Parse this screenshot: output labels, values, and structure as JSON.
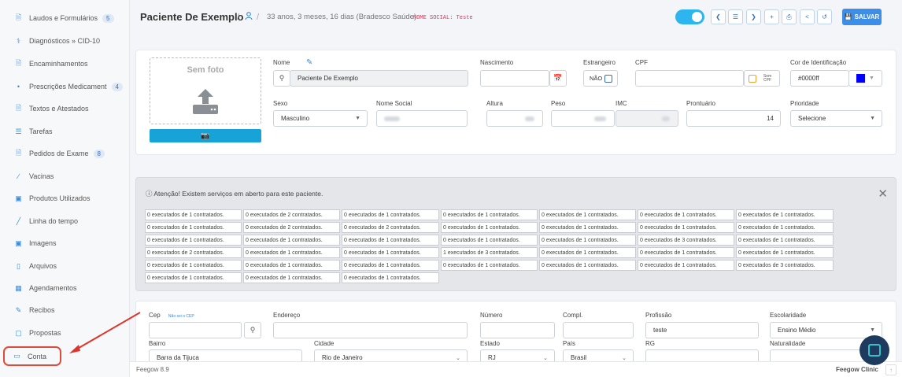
{
  "sidebar": {
    "items": [
      {
        "label": "Laudos e Formulários",
        "badge": "5",
        "icon": "file-icon"
      },
      {
        "label": "Diagnósticos » CID-10",
        "badge": "",
        "icon": "stethoscope-icon"
      },
      {
        "label": "Encaminhamentos",
        "badge": "",
        "icon": "file-icon"
      },
      {
        "label": "Prescrições Medicament",
        "badge": "4",
        "icon": "pills-icon"
      },
      {
        "label": "Textos e Atestados",
        "badge": "",
        "icon": "file-icon"
      },
      {
        "label": "Tarefas",
        "badge": "",
        "icon": "list-icon"
      },
      {
        "label": "Pedidos de Exame",
        "badge": "8",
        "icon": "file-icon"
      },
      {
        "label": "Vacinas",
        "badge": "",
        "icon": "syringe-icon"
      },
      {
        "label": "Produtos Utilizados",
        "badge": "",
        "icon": "box-icon"
      },
      {
        "label": "Linha do tempo",
        "badge": "",
        "icon": "chart-line-icon"
      },
      {
        "label": "Imagens",
        "badge": "",
        "icon": "image-icon"
      },
      {
        "label": "Arquivos",
        "badge": "",
        "icon": "document-icon"
      },
      {
        "label": "Agendamentos",
        "badge": "",
        "icon": "calendar-icon"
      },
      {
        "label": "Recibos",
        "badge": "",
        "icon": "edit-icon"
      },
      {
        "label": "Propostas",
        "badge": "",
        "icon": "copy-icon"
      },
      {
        "label": "Conta",
        "badge": "",
        "icon": "account-icon"
      }
    ]
  },
  "header": {
    "patient_name": "Paciente De Exemplo",
    "separator": "/",
    "age_info": "33 anos, 3 meses, 16 dias (Bradesco Saúde)",
    "social_name": "NOME SOCIAL: Teste",
    "save_label": "SALVAR"
  },
  "photo": {
    "label": "Sem foto"
  },
  "form": {
    "nome_label": "Nome",
    "nome_value": "Paciente De Exemplo",
    "nascimento_label": "Nascimento",
    "estrangeiro_label": "Estrangeiro",
    "estrangeiro_value": "NÃO",
    "cpf_label": "CPF",
    "sem_cpf": "Sem CPF",
    "cor_label": "Cor de Identificação",
    "cor_value": "#0000ff",
    "sexo_label": "Sexo",
    "sexo_value": "Masculino",
    "nome_social_label": "Nome Social",
    "altura_label": "Altura",
    "peso_label": "Peso",
    "imc_label": "IMC",
    "prontuario_label": "Prontuário",
    "prontuario_value": "14",
    "prioridade_label": "Prioridade",
    "prioridade_value": "Selecione"
  },
  "alert": {
    "title": "ⓘ Atenção! Existem serviços em aberto para este paciente.",
    "rows": [
      [
        "0 executados de 1 contratados.",
        "0 executados de 2 contratados.",
        "0 executados de 1 contratados.",
        "0 executados de 1 contratados.",
        "0 executados de 1 contratados.",
        "0 executados de 1 contratados.",
        "0 executados de 1 contratados."
      ],
      [
        "0 executados de 1 contratados.",
        "0 executados de 2 contratados.",
        "0 executados de 2 contratados.",
        "0 executados de 1 contratados.",
        "0 executados de 1 contratados.",
        "0 executados de 1 contratados.",
        "0 executados de 1 contratados."
      ],
      [
        "0 executados de 1 contratados.",
        "0 executados de 1 contratados.",
        "0 executados de 1 contratados.",
        "0 executados de 1 contratados.",
        "0 executados de 1 contratados.",
        "0 executados de 3 contratados.",
        "0 executados de 1 contratados."
      ],
      [
        "0 executados de 2 contratados.",
        "0 executados de 1 contratados.",
        "0 executados de 1 contratados.",
        "1 executados de 3 contratados.",
        "0 executados de 1 contratados.",
        "0 executados de 1 contratados.",
        "0 executados de 1 contratados."
      ],
      [
        "0 executados de 1 contratados.",
        "0 executados de 1 contratados.",
        "0 executados de 1 contratados.",
        "0 executados de 1 contratados.",
        "0 executados de 1 contratados.",
        "0 executados de 1 contratados.",
        "0 executados de 3 contratados."
      ],
      [
        "0 executados de 1 contratados.",
        "0 executados de 1 contratados.",
        "0 executados de 1 contratados."
      ]
    ]
  },
  "address": {
    "cep_label": "Cep",
    "cep_link": "Não sei o CEP",
    "endereco_label": "Endereço",
    "numero_label": "Número",
    "compl_label": "Compl.",
    "profissao_label": "Profissão",
    "profissao_value": "teste",
    "escolaridade_label": "Escolaridade",
    "escolaridade_value": "Ensino Médio",
    "bairro_label": "Bairro",
    "bairro_value": "Barra da Tijuca",
    "cidade_label": "Cidade",
    "cidade_value": "Rio de Janeiro",
    "estado_label": "Estado",
    "estado_value": "RJ",
    "pais_label": "País",
    "pais_value": "Brasil",
    "rg_label": "RG",
    "naturalidade_label": "Naturalidade"
  },
  "footer": {
    "version": "Feegow 8.9",
    "brand": "Feegow Clinic"
  },
  "colors": {
    "accent": "#3d8ee6",
    "highlight": "#e04a3a",
    "toggle": "#2db5f0",
    "identification": "#0000ff"
  }
}
